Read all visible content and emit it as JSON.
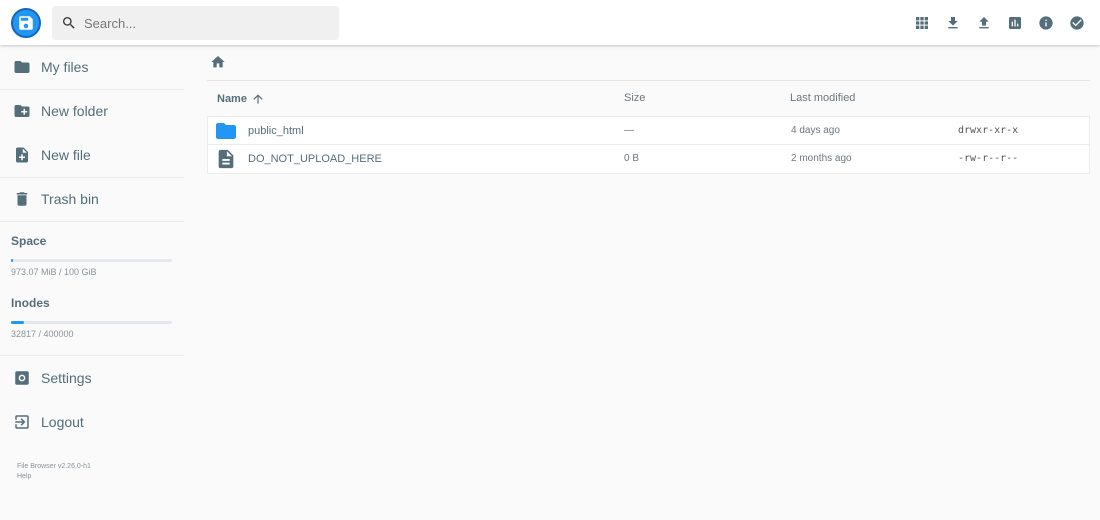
{
  "header": {
    "search": {
      "placeholder": "Search..."
    },
    "actions": [
      {
        "icon": "grid-view-icon",
        "label": "Switch view"
      },
      {
        "icon": "download-icon",
        "label": "Download"
      },
      {
        "icon": "upload-icon",
        "label": "Upload"
      },
      {
        "icon": "bar-chart-icon",
        "label": "Stats"
      },
      {
        "icon": "info-icon",
        "label": "Info"
      },
      {
        "icon": "check-circle-icon",
        "label": "Select multiple"
      }
    ]
  },
  "sidebar": {
    "items": [
      {
        "label": "My files",
        "icon": "folder-icon"
      },
      {
        "label": "New folder",
        "icon": "create-folder-icon"
      },
      {
        "label": "New file",
        "icon": "note-add-icon"
      },
      {
        "label": "Trash bin",
        "icon": "trash-icon"
      }
    ],
    "space": {
      "title": "Space",
      "text": "973.07 MiB / 100 GiB",
      "fraction": 0.0095
    },
    "inodes": {
      "title": "Inodes",
      "text": "32817 / 400000",
      "fraction": 0.082
    },
    "settings_label": "Settings",
    "logout_label": "Logout",
    "footer": {
      "version": "File Browser v2.26.0-h1",
      "help": "Help"
    }
  },
  "main": {
    "columns": {
      "name": "Name",
      "size": "Size",
      "modified": "Last modified"
    },
    "files": [
      {
        "name": "public_html",
        "type": "folder",
        "size": "—",
        "modified": "4 days ago",
        "perms": "drwxr-xr-x"
      },
      {
        "name": "DO_NOT_UPLOAD_HERE",
        "type": "file",
        "size": "0 B",
        "modified": "2 months ago",
        "perms": "-rw-r--r--"
      }
    ]
  },
  "colors": {
    "accent": "#2196f3",
    "text": "#546e7a"
  }
}
